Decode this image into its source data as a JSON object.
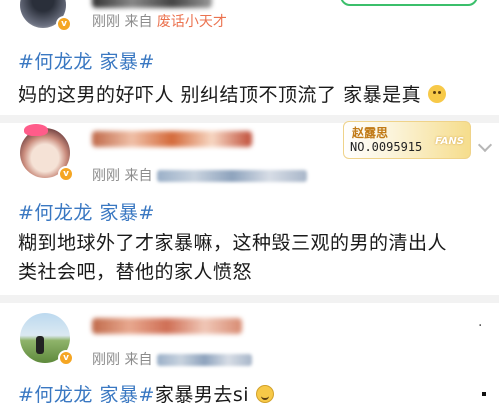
{
  "post1": {
    "time": "刚刚",
    "from": "来自",
    "source": "废话小天才",
    "hashtag": "#何龙龙 家暴#",
    "body": "妈的这男的好吓人 别纠结顶不顶流了 家暴是真",
    "emoji": "emoji-face"
  },
  "post2": {
    "fans_badge_name": "赵露思",
    "fans_badge_no": "NO.0095915",
    "fans_badge_word": "FANS",
    "time": "刚刚",
    "from": "来自",
    "hashtag": "#何龙龙 家暴#",
    "body_line1": "糊到地球外了才家暴嘛，这种毁三观的男的清出人",
    "body_line2": "类社会吧，替他的家人愤怒"
  },
  "post3": {
    "time": "刚刚",
    "from": "来自",
    "hashtag": "#何龙龙 家暴#",
    "body": "家暴男去si",
    "emoji": "emoji-smile",
    "dots": "·"
  },
  "colors": {
    "hashtag": "#3a78c2",
    "source": "#eb7350",
    "meta": "#8c8c8c",
    "badge": "#f5a623"
  }
}
